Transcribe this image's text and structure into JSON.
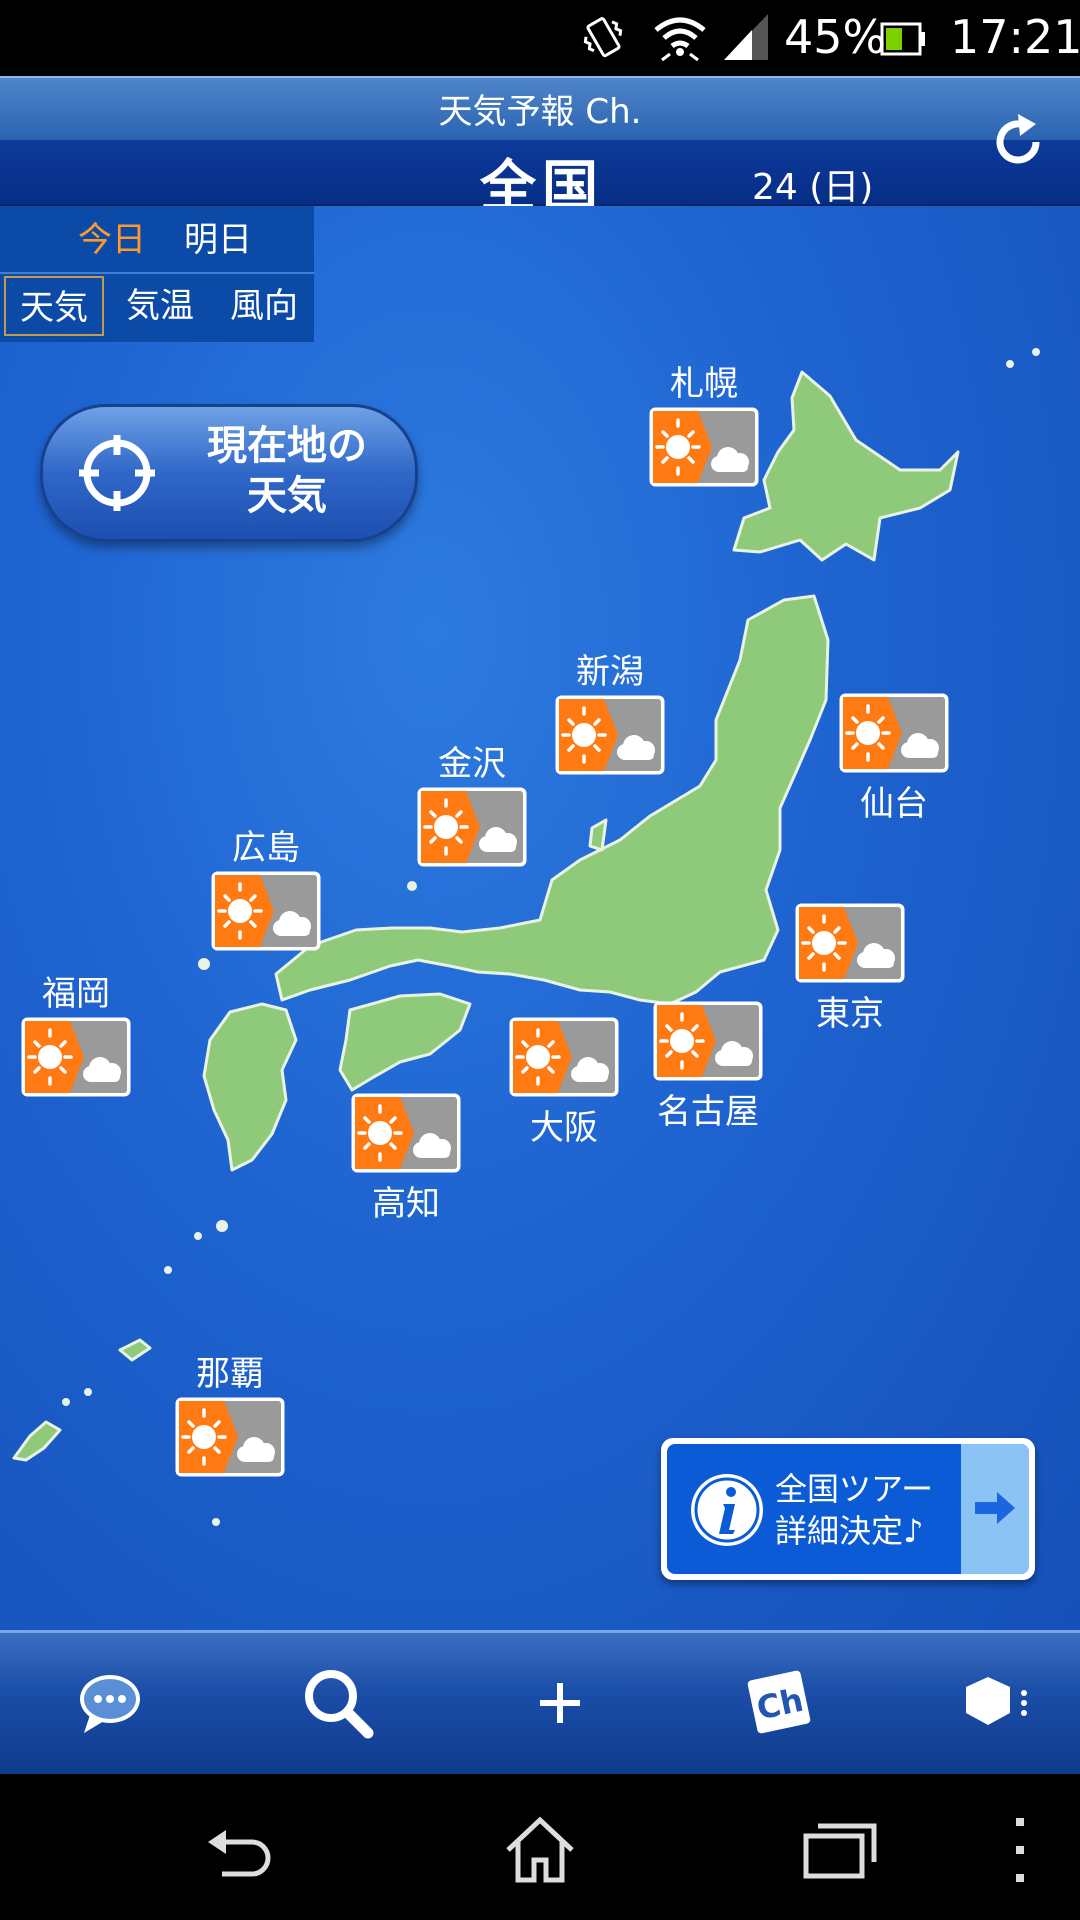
{
  "status_bar": {
    "battery": "45%",
    "time": "17:21"
  },
  "header": {
    "app_title": "天気予報 Ch.",
    "region": "全国",
    "date": "24 (日)"
  },
  "day_tabs": [
    {
      "label": "今日",
      "selected": true
    },
    {
      "label": "明日",
      "selected": false
    }
  ],
  "kind_tabs": [
    {
      "label": "天気",
      "selected": true
    },
    {
      "label": "気温",
      "selected": false
    },
    {
      "label": "風向",
      "selected": false
    }
  ],
  "location_button": {
    "label_line1": "現在地の",
    "label_line2": "天気"
  },
  "cities": [
    {
      "name": "札幌",
      "forecast": "sunny-then-cloudy"
    },
    {
      "name": "新潟",
      "forecast": "sunny-then-cloudy"
    },
    {
      "name": "仙台",
      "forecast": "sunny-then-cloudy"
    },
    {
      "name": "金沢",
      "forecast": "sunny-then-cloudy"
    },
    {
      "name": "広島",
      "forecast": "sunny-then-cloudy"
    },
    {
      "name": "東京",
      "forecast": "sunny-then-cloudy"
    },
    {
      "name": "福岡",
      "forecast": "sunny-then-cloudy"
    },
    {
      "name": "名古屋",
      "forecast": "sunny-then-cloudy"
    },
    {
      "name": "大阪",
      "forecast": "sunny-then-cloudy"
    },
    {
      "name": "高知",
      "forecast": "sunny-then-cloudy"
    },
    {
      "name": "那覇",
      "forecast": "sunny-then-cloudy"
    }
  ],
  "banner": {
    "line1": "全国ツアー",
    "line2": "詳細決定♪"
  },
  "toolbar": {
    "icons": [
      "chat-icon",
      "search-icon",
      "plus-icon",
      "channel-icon",
      "menu-icon"
    ],
    "ch_label": "Ch"
  },
  "colors": {
    "sea": "#1e63d0",
    "land": "#8fc97a",
    "forecast_orange": "#ff7a12",
    "selected_tab_text": "#ff9a2a"
  }
}
